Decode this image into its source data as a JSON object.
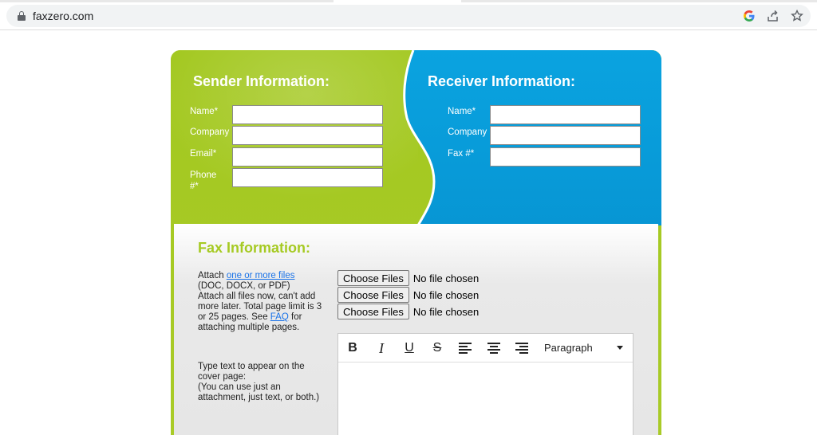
{
  "browser": {
    "url": "faxzero.com"
  },
  "sender": {
    "title": "Sender Information:",
    "fields": {
      "name": "Name*",
      "company": "Company",
      "email": "Email*",
      "phone_line1": "Phone",
      "phone_line2": "#*"
    }
  },
  "receiver": {
    "title": "Receiver Information:",
    "fields": {
      "name": "Name*",
      "company": "Company",
      "fax": "Fax #*"
    }
  },
  "fax": {
    "title": "Fax Information:",
    "attach": {
      "prefix": "Attach ",
      "link": "one or more files",
      "formats": "(DOC, DOCX, or PDF)",
      "line3": "Attach all files now, can't add",
      "line4": "more later. Total page limit is 3",
      "line5_prefix": "or 25 pages. See ",
      "faq_link": "FAQ",
      "line5_suffix": " for",
      "line6": "attaching multiple pages."
    },
    "file_button": "Choose Files",
    "no_file": "No file chosen",
    "cover": {
      "line1": "Type text to appear on the",
      "line2": "cover page:",
      "line3": "(You can use just an",
      "line4": "attachment, just text, or both.)"
    },
    "editor": {
      "bold": "B",
      "italic": "I",
      "underline": "U",
      "strike": "S",
      "block_format": "Paragraph"
    }
  },
  "colors": {
    "sender_green": "#a6ca23",
    "receiver_blue": "#0a9fdc",
    "fax_title_green": "#a6ca23"
  }
}
